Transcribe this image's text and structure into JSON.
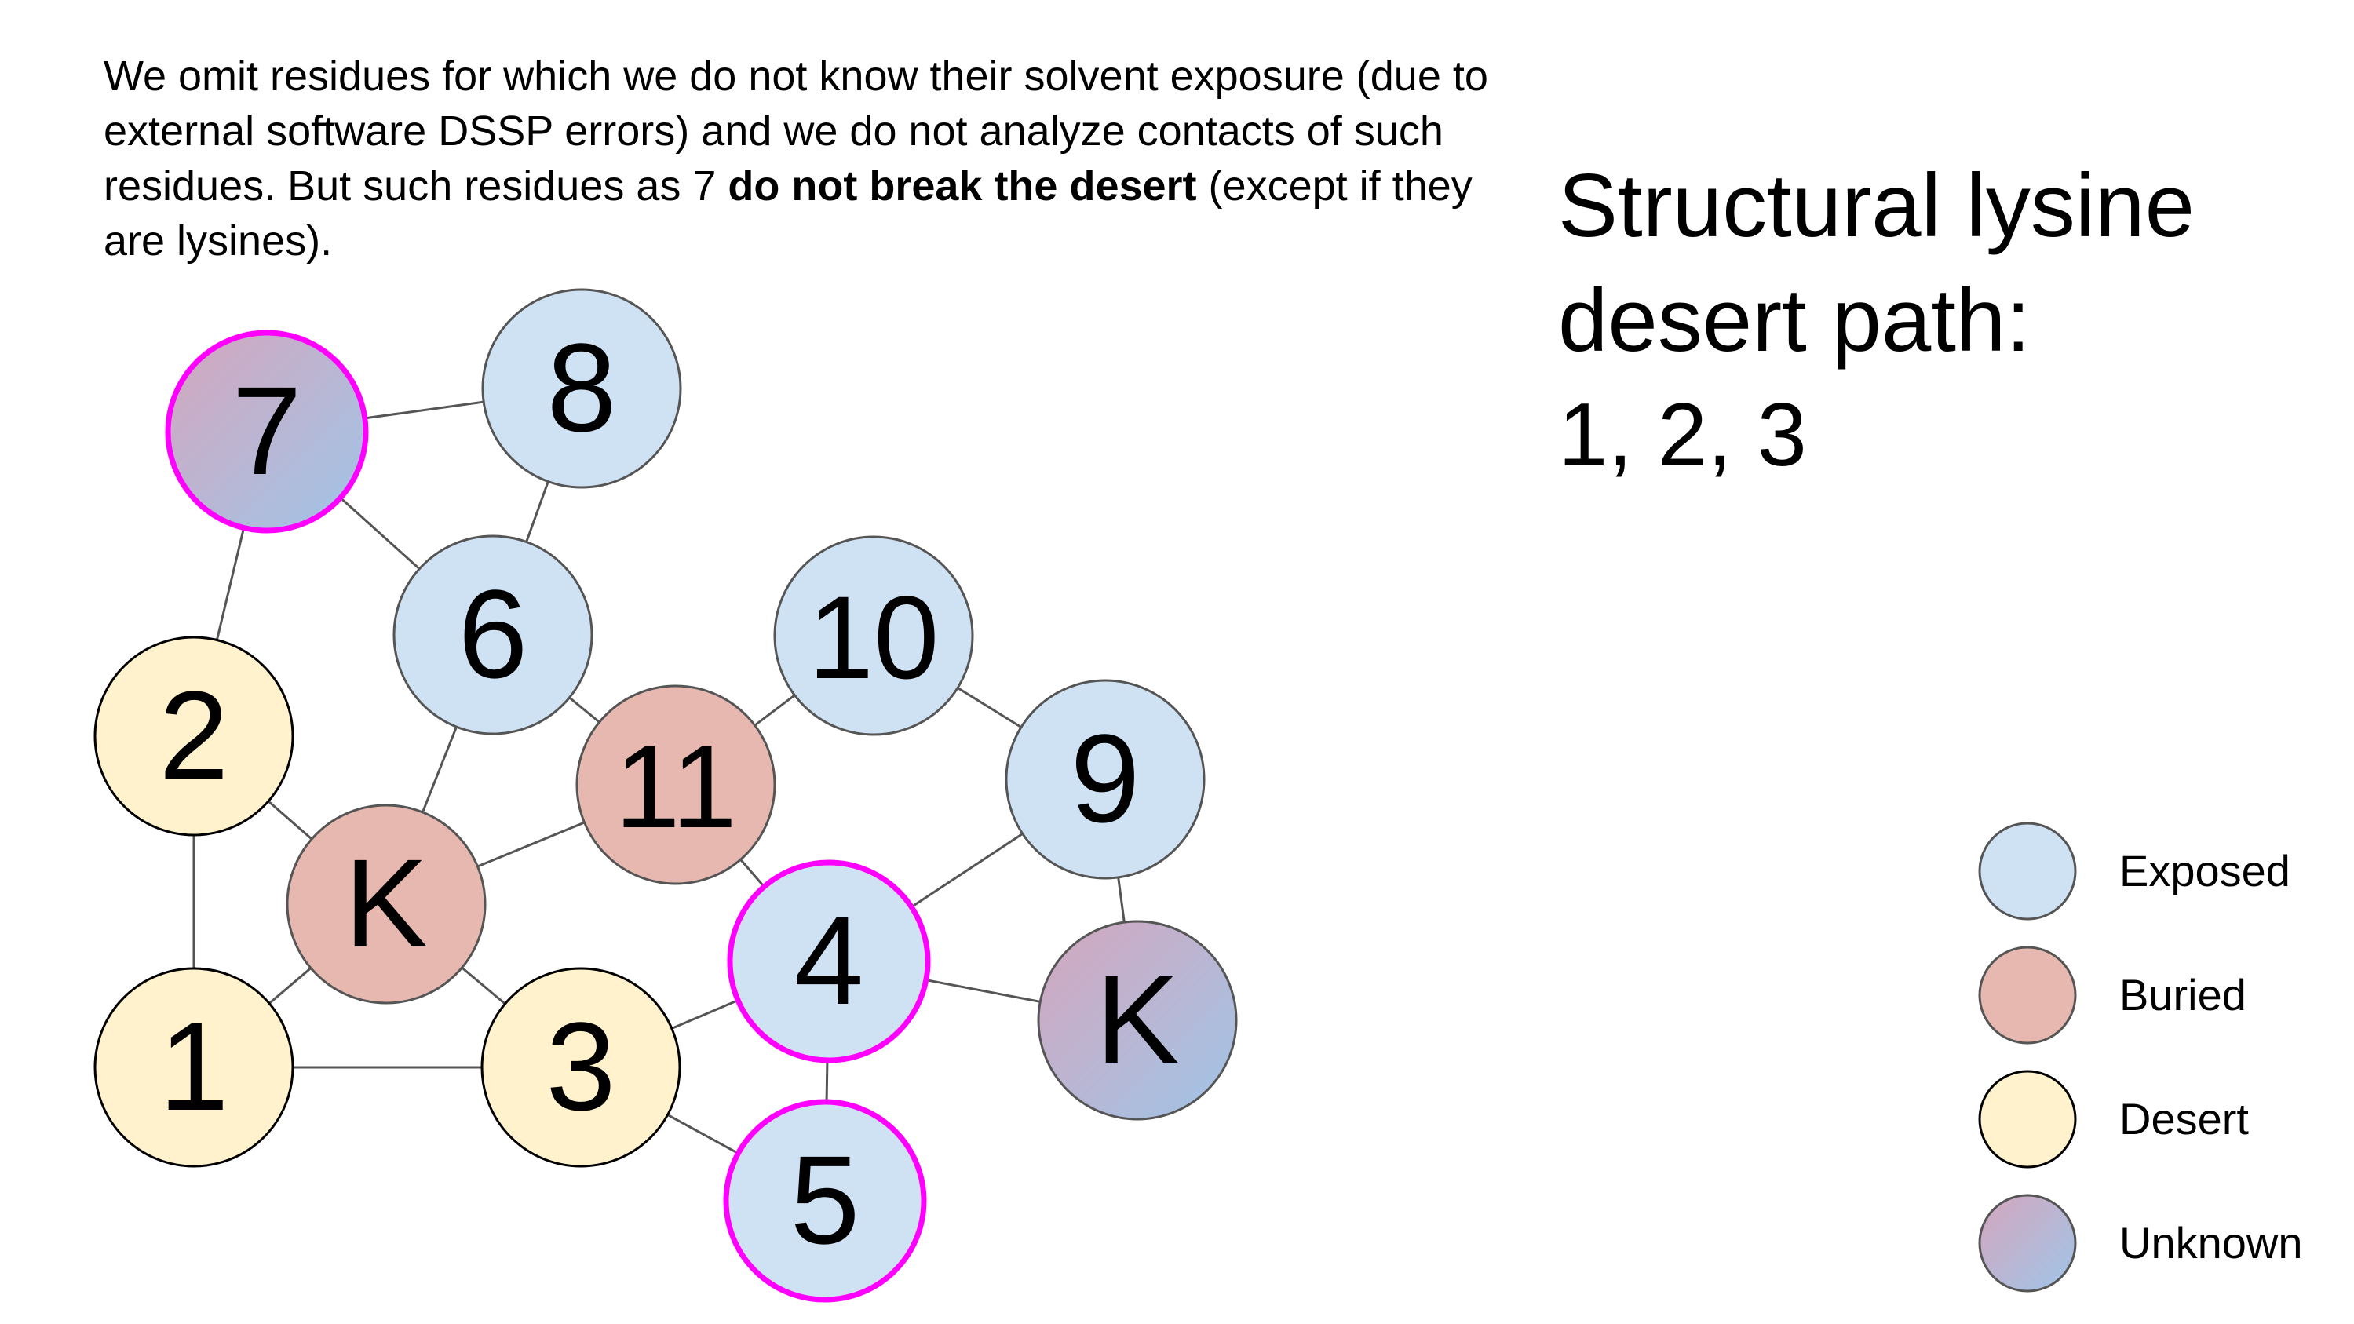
{
  "note": {
    "part1": "We omit residues for which we do not know their solvent exposure (due to external software DSSP errors) and we do not analyze contacts of such residues. But such residues as 7 ",
    "bold1": "do not break the desert",
    "part2": " (except if they are lysines)."
  },
  "side_title": {
    "line1": "Structural lysine",
    "line2": "desert path:",
    "line3": "1, 2, 3"
  },
  "colors": {
    "exposed": "#cfe2f3",
    "buried": "#e6b8af",
    "desert": "#fff2cc",
    "unknown_a": "#d5a6bd",
    "unknown_b": "#9fc5e8",
    "highlight": "#ff00ff",
    "edge": "#555555",
    "node_border": "#555555"
  },
  "nodes": [
    {
      "id": "n7",
      "label": "7",
      "state": "unknown",
      "highlight": true
    },
    {
      "id": "n8",
      "label": "8",
      "state": "exposed",
      "highlight": false
    },
    {
      "id": "n6",
      "label": "6",
      "state": "exposed",
      "highlight": false
    },
    {
      "id": "n10",
      "label": "10",
      "state": "exposed",
      "highlight": false
    },
    {
      "id": "n2",
      "label": "2",
      "state": "desert",
      "highlight": false
    },
    {
      "id": "n11",
      "label": "11",
      "state": "buried",
      "highlight": false
    },
    {
      "id": "n9",
      "label": "9",
      "state": "exposed",
      "highlight": false
    },
    {
      "id": "nK1",
      "label": "K",
      "state": "buried",
      "highlight": false
    },
    {
      "id": "n4",
      "label": "4",
      "state": "exposed",
      "highlight": true
    },
    {
      "id": "nK2",
      "label": "K",
      "state": "unknown",
      "highlight": false
    },
    {
      "id": "n1",
      "label": "1",
      "state": "desert",
      "highlight": false
    },
    {
      "id": "n3",
      "label": "3",
      "state": "desert",
      "highlight": false
    },
    {
      "id": "n5",
      "label": "5",
      "state": "exposed",
      "highlight": true
    }
  ],
  "edges": [
    [
      "n7",
      "n8"
    ],
    [
      "n7",
      "n6"
    ],
    [
      "n7",
      "n2"
    ],
    [
      "n8",
      "n6"
    ],
    [
      "n6",
      "n11"
    ],
    [
      "n6",
      "nK1"
    ],
    [
      "n11",
      "n10"
    ],
    [
      "n11",
      "nK1"
    ],
    [
      "n11",
      "n4"
    ],
    [
      "n10",
      "n9"
    ],
    [
      "n9",
      "n4"
    ],
    [
      "n9",
      "nK2"
    ],
    [
      "n2",
      "nK1"
    ],
    [
      "n2",
      "n1"
    ],
    [
      "nK1",
      "n1"
    ],
    [
      "nK1",
      "n3"
    ],
    [
      "n1",
      "n3"
    ],
    [
      "n3",
      "n4"
    ],
    [
      "n3",
      "n5"
    ],
    [
      "n4",
      "n5"
    ],
    [
      "n4",
      "nK2"
    ]
  ],
  "legend": [
    {
      "state": "exposed",
      "label": "Exposed"
    },
    {
      "state": "buried",
      "label": "Buried"
    },
    {
      "state": "desert",
      "label": "Desert"
    },
    {
      "state": "unknown",
      "label": "Unknown"
    }
  ]
}
